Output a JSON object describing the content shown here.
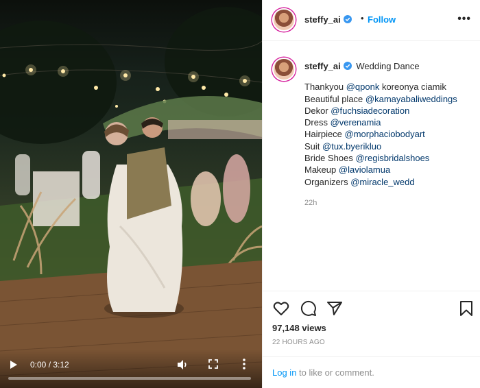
{
  "video": {
    "current_time": "0:00",
    "duration": "3:12",
    "time_separator": " / ",
    "progress": 0.0,
    "icons": [
      "play-icon",
      "volume-icon",
      "fullscreen-icon",
      "more-vertical-icon"
    ]
  },
  "post": {
    "username": "steffy_ai",
    "verified": true,
    "separator": "•",
    "follow_label": "Follow",
    "more_label": "•••",
    "caption_title": "Wedding Dance",
    "caption_lines": [
      {
        "text": "Thankyou ",
        "tag": "@qponk",
        "after": " koreonya ciamik"
      },
      {
        "text": "Beautiful place ",
        "tag": "@kamayabaliweddings",
        "after": ""
      },
      {
        "text": "Dekor ",
        "tag": "@fuchsiadecoration",
        "after": ""
      },
      {
        "text": "Dress ",
        "tag": "@verenamia",
        "after": ""
      },
      {
        "text": "Hairpiece ",
        "tag": "@morphaciobodyart",
        "after": ""
      },
      {
        "text": "Suit ",
        "tag": "@tux.byerikluo",
        "after": ""
      },
      {
        "text": "Bride Shoes ",
        "tag": "@regisbridalshoes",
        "after": ""
      },
      {
        "text": "Makeup ",
        "tag": "@laviolamua",
        "after": ""
      },
      {
        "text": "Organizers ",
        "tag": "@miracle_wedd",
        "after": ""
      }
    ],
    "caption_age": "22h",
    "views": "97,148 views",
    "timestamp": "22 HOURS AGO",
    "login_link": "Log in",
    "login_suffix": " to like or comment."
  },
  "colors": {
    "accent": "#0095f6",
    "tag": "#00376b",
    "muted": "#8e8e8e",
    "text": "#262626",
    "verified": "#3897f0"
  }
}
